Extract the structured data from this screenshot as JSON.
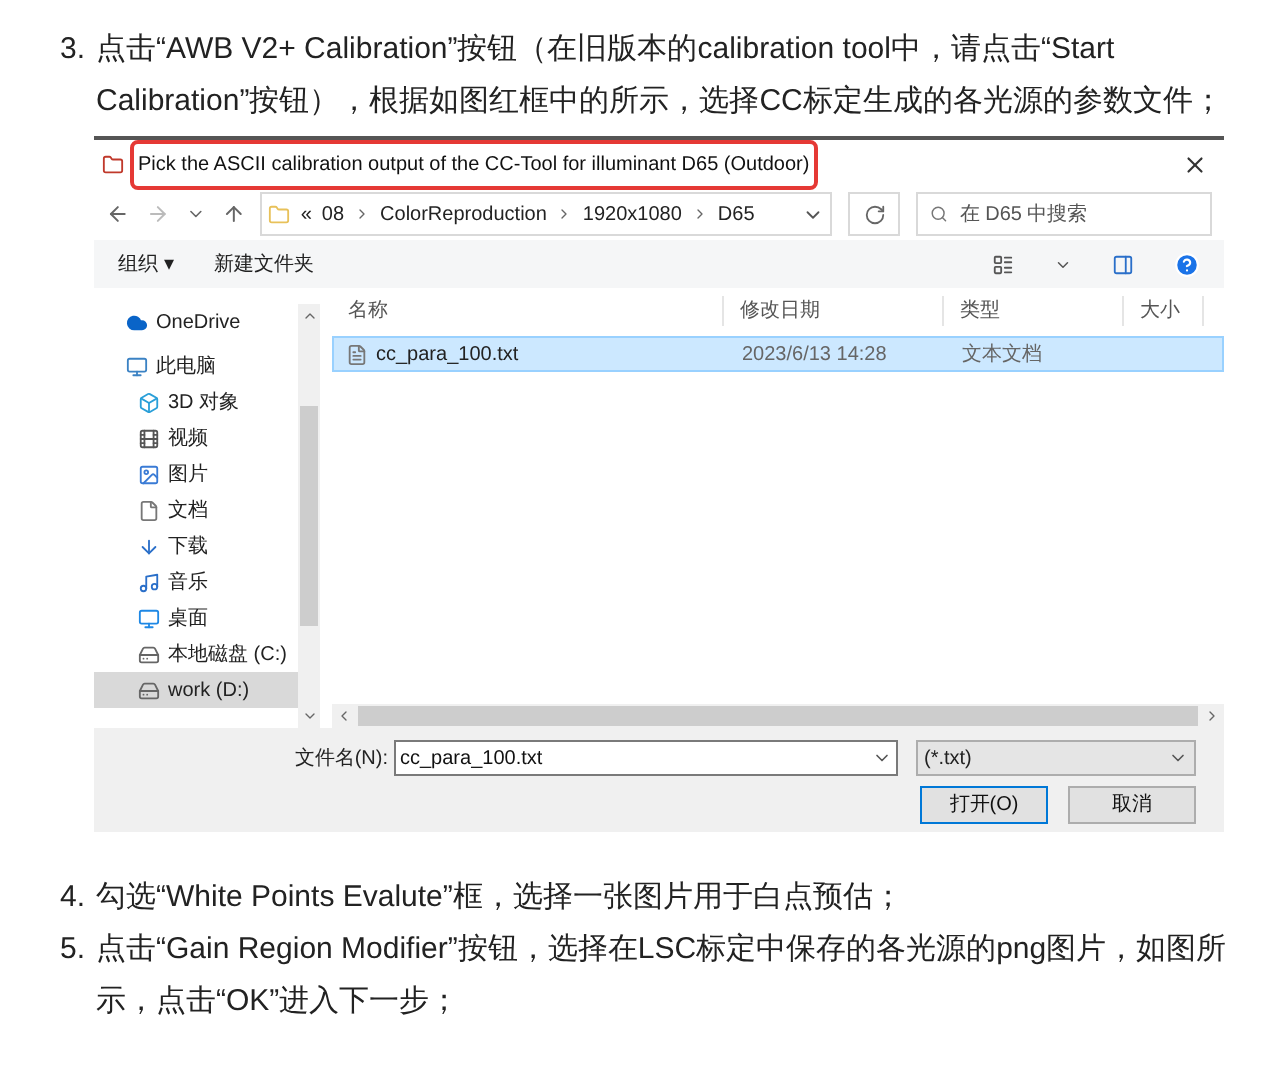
{
  "steps_before": [
    {
      "number": "3.",
      "text": "点击“AWB V2+ Calibration”按钮（在旧版本的calibration tool中，请点击“Start Calibration”按钮），根据如图红框中的所示，选择CC标定生成的各光源的参数文件；"
    }
  ],
  "dialog": {
    "title": "Pick the ASCII calibration output of the CC-Tool for illuminant D65 (Outdoor)",
    "highlighted": true,
    "breadcrumb": [
      "«",
      "08",
      "ColorReproduction",
      "1920x1080",
      "D65"
    ],
    "search": {
      "placeholder": "在 D65 中搜索"
    },
    "toolbar": [
      "组织 ▾",
      "新建文件夹"
    ],
    "nav": [
      {
        "label": "OneDrive",
        "selected": false
      },
      {
        "label": "此电脑",
        "selected": false,
        "children": [
          {
            "label": "3D 对象",
            "selected": false
          },
          {
            "label": "视频",
            "selected": false
          },
          {
            "label": "图片",
            "selected": false
          },
          {
            "label": "文档",
            "selected": false
          },
          {
            "label": "下载",
            "selected": false
          },
          {
            "label": "音乐",
            "selected": false
          },
          {
            "label": "桌面",
            "selected": false
          },
          {
            "label": "本地磁盘 (C:)",
            "selected": false
          },
          {
            "label": "work (D:)",
            "selected": true
          }
        ]
      }
    ],
    "columns": [
      "名称",
      "修改日期",
      "类型",
      "大小"
    ],
    "rows": [
      {
        "name": "cc_para_100.txt",
        "modified": "2023/6/13 14:28",
        "type": "文本文档",
        "selected": true
      }
    ],
    "filename_label": "文件名(N):",
    "filename": "cc_para_100.txt",
    "filter": "(*.txt)",
    "buttons": [
      "打开(O)",
      "取消"
    ]
  },
  "steps_after": [
    {
      "number": "4.",
      "text": "勾选“White Points Evalute”框，选择一张图片用于白点预估；"
    },
    {
      "number": "5.",
      "text": "点击“Gain Region Modifier”按钮，选择在LSC标定中保存的各光源的png图片，如图所示，点击“OK”进入下一步；"
    }
  ]
}
